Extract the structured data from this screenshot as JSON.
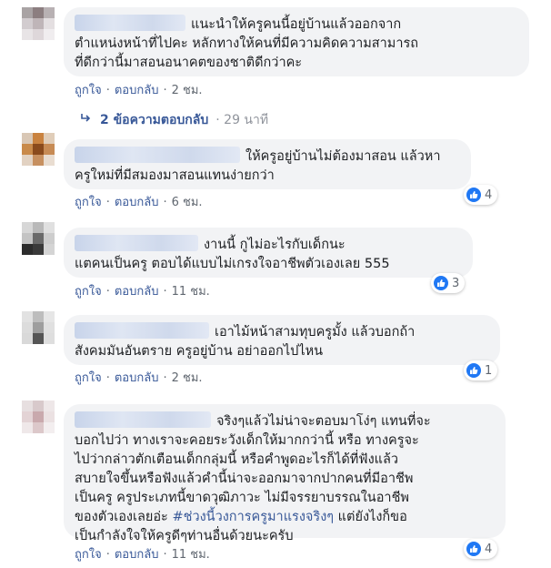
{
  "colors": {
    "bubble_bg": "#f2f3f5",
    "link": "#385898",
    "meta": "#606770",
    "like_blue": "#2078f4"
  },
  "comments": [
    {
      "text_lines": [
        "แนะนำให้ครูคนนี้อยู่บ้านแล้วออกจาก",
        "ตำแหน่งหน้าที่ไปคะ หลักทางให้คนที่มีความคิดความสามารถ",
        "ที่ดีกว่านี้มาสอนอนาคตของชาติดีกว่าคะ"
      ],
      "like": "ถูกใจ",
      "reply": "ตอบกลับ",
      "time": "2 ชม.",
      "reactions": ""
    },
    {
      "text_lines": [
        "ให้ครูอยู่บ้านไม่ต้องมาสอน แล้วหา",
        "ครูใหม่ที่มีสมองมาสอนแทนง่ายกว่า"
      ],
      "like": "ถูกใจ",
      "reply": "ตอบกลับ",
      "time": "6 ชม.",
      "reactions": "4"
    },
    {
      "text_lines": [
        "งานนี้ กูไม่อะไรกับเด็กนะ",
        "แตคนเป็นครู ตอบได้แบบไม่เกรงใจอาชีพตัวเองเลย 555"
      ],
      "like": "ถูกใจ",
      "reply": "ตอบกลับ",
      "time": "11 ชม.",
      "reactions": "3"
    },
    {
      "text_lines": [
        "เอาไม้หน้าสามทุบครูมั้ง แล้วบอกถ้า",
        "สังคมมันอันตราย ครูอยู่บ้าน อย่าออกไปไหน"
      ],
      "like": "ถูกใจ",
      "reply": "ตอบกลับ",
      "time": "2 ชม.",
      "reactions": "1"
    },
    {
      "text_lines": [
        "จริงๆแล้วไม่น่าจะตอบมาโง่ๆ แทนที่จะ",
        "บอกไปว่า ทางเราจะคอยระวังเด็กให้มากกว่านี้ หรือ ทางครูจะ",
        "ไปว่ากล่าวตักเตือนเด็กกลุ่มนี้ หรือคำพูดอะไรก็ได้ที่ฟังแล้ว",
        "สบายใจขึ้นหรือฟังแล้วคำนี้น่าจะออกมาจากปากคนที่มีอาชีพ",
        "เป็นครู ครูประเภทนี้ขาดวุฒิภาวะ ไม่มีจรรยาบรรณในอาชีพ"
      ],
      "last_line_pre": "ของตัวเองเลยอ่ะ ",
      "hashtag": "#ช่วงนี้วงการครูมาแรงจริงๆ",
      "last_line_post": " แต่ยังไงก็ขอ",
      "final_line": "เป็นกำลังใจให้ครูดีๆท่านอื่นด้วยนะครับ",
      "like": "ถูกใจ",
      "reply": "ตอบกลับ",
      "time": "11 ชม.",
      "reactions": "4"
    }
  ],
  "replies_link": {
    "label": "2 ข้อความตอบกลับ",
    "separator": "·",
    "time": "29 นาที"
  },
  "icons": {
    "reply_arrow": "reply-arrow-icon",
    "like": "thumbs-up-icon"
  }
}
